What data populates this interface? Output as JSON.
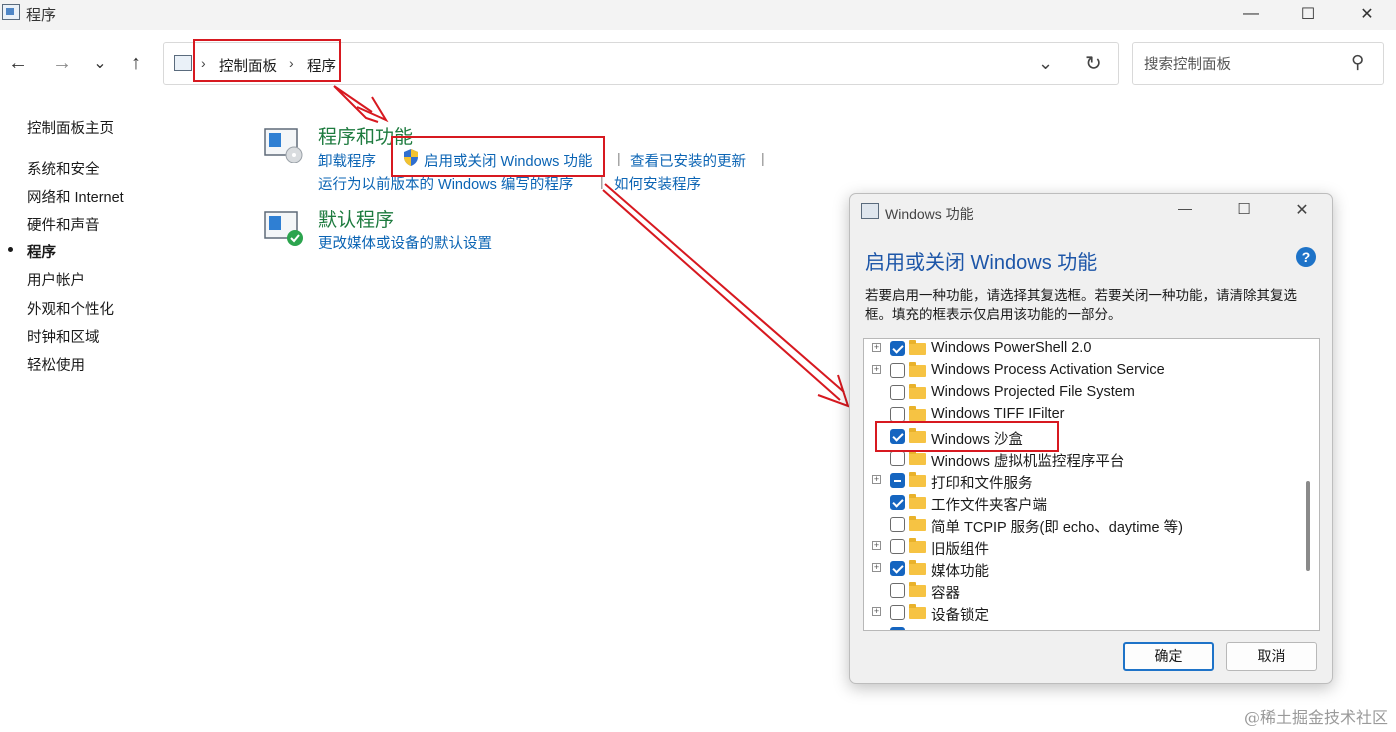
{
  "window": {
    "title": "程序",
    "minimize_icon": "—",
    "maximize_icon": "☐",
    "close_icon": "✕"
  },
  "nav": {
    "back_icon": "←",
    "forward_icon": "→",
    "recent_icon": "⌄",
    "up_icon": "↑",
    "breadcrumb": [
      "控制面板",
      "程序"
    ],
    "breadcrumb_sep": "›",
    "dropdown_icon": "⌄",
    "refresh_icon": "↻",
    "search_placeholder": "搜索控制面板",
    "search_icon": "⚲"
  },
  "sidebar": {
    "items": [
      {
        "label": "控制面板主页"
      },
      {
        "label": "系统和安全"
      },
      {
        "label": "网络和 Internet"
      },
      {
        "label": "硬件和声音"
      },
      {
        "label": "程序",
        "active": true
      },
      {
        "label": "用户帐户"
      },
      {
        "label": "外观和个性化"
      },
      {
        "label": "时钟和区域"
      },
      {
        "label": "轻松使用"
      }
    ]
  },
  "main": {
    "programs": {
      "title": "程序和功能",
      "links": [
        "卸载程序",
        "启用或关闭 Windows 功能",
        "查看已安装的更新",
        "运行为以前版本的 Windows 编写的程序",
        "如何安装程序"
      ],
      "separator": "|"
    },
    "defaults": {
      "title": "默认程序",
      "link": "更改媒体或设备的默认设置"
    }
  },
  "dialog": {
    "title": "Windows 功能",
    "heading": "启用或关闭 Windows 功能",
    "help": "?",
    "description": "若要启用一种功能，请选择其复选框。若要关闭一种功能，请清除其复选框。填充的框表示仅启用该功能的一部分。",
    "features": [
      {
        "label": "Windows PowerShell 2.0",
        "state": "checked",
        "expandable": true
      },
      {
        "label": "Windows Process Activation Service",
        "state": "unchecked",
        "expandable": true
      },
      {
        "label": "Windows Projected File System",
        "state": "unchecked",
        "expandable": false
      },
      {
        "label": "Windows TIFF IFilter",
        "state": "unchecked",
        "expandable": false
      },
      {
        "label": "Windows 沙盒",
        "state": "checked",
        "expandable": false
      },
      {
        "label": "Windows 虚拟机监控程序平台",
        "state": "unchecked",
        "expandable": false
      },
      {
        "label": "打印和文件服务",
        "state": "partial",
        "expandable": true
      },
      {
        "label": "工作文件夹客户端",
        "state": "checked",
        "expandable": false
      },
      {
        "label": "简单 TCPIP 服务(即 echo、daytime 等)",
        "state": "unchecked",
        "expandable": false
      },
      {
        "label": "旧版组件",
        "state": "unchecked",
        "expandable": true
      },
      {
        "label": "媒体功能",
        "state": "checked",
        "expandable": true
      },
      {
        "label": "容器",
        "state": "unchecked",
        "expandable": false
      },
      {
        "label": "设备锁定",
        "state": "unchecked",
        "expandable": true
      }
    ],
    "ok_label": "确定",
    "cancel_label": "取消"
  },
  "annotation_color": "#d71920",
  "accent_color": "#1565c0",
  "watermark": "@稀土掘金技术社区"
}
